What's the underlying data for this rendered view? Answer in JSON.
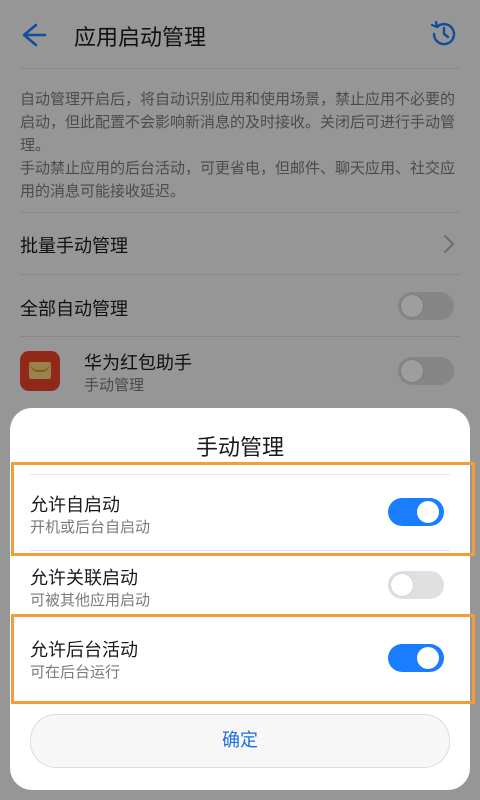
{
  "header": {
    "title": "应用启动管理",
    "back_icon": "back-arrow-icon",
    "history_icon": "history-clock-icon"
  },
  "description": {
    "para1": "自动管理开启后，将自动识别应用和使用场景，禁止应用不必要的启动，但此配置不会影响新消息的及时接收。关闭后可进行手动管理。",
    "para2": "手动禁止应用的后台活动，可更省电，但邮件、聊天应用、社交应用的消息可能接收延迟。"
  },
  "list": {
    "batch_manage": "批量手动管理",
    "auto_all": {
      "label": "全部自动管理",
      "on": false
    },
    "app": {
      "name": "华为红包助手",
      "mode": "手动管理",
      "on": false
    }
  },
  "dialog": {
    "title": "手动管理",
    "options": [
      {
        "title": "允许自启动",
        "subtitle": "开机或后台自启动",
        "on": true,
        "highlighted": true
      },
      {
        "title": "允许关联启动",
        "subtitle": "可被其他应用启动",
        "on": false,
        "highlighted": false
      },
      {
        "title": "允许后台活动",
        "subtitle": "可在后台运行",
        "on": true,
        "highlighted": true
      }
    ],
    "confirm_label": "确定"
  },
  "colors": {
    "accent": "#1a7dff",
    "highlight": "#f39c3a",
    "switch_off": "#e0e0e0"
  }
}
